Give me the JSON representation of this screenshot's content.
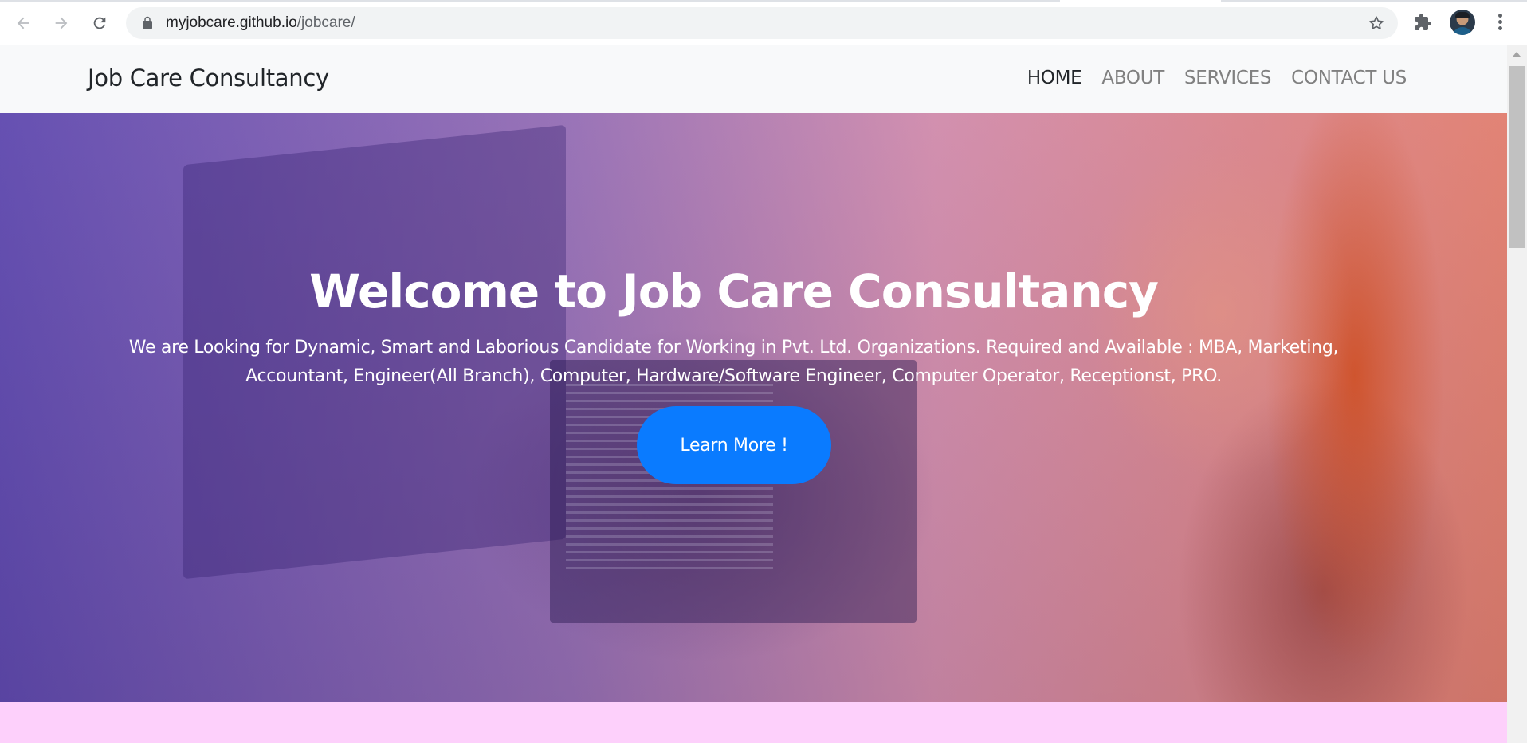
{
  "browser": {
    "url_host": "myjobcare.github.io",
    "url_path": "/jobcare/",
    "back_icon": "arrow-left-icon",
    "forward_icon": "arrow-right-icon",
    "reload_icon": "reload-icon",
    "lock_icon": "lock-icon",
    "bookmark_icon": "star-icon",
    "extensions_icon": "puzzle-icon",
    "menu_icon": "kebab-menu-icon"
  },
  "site": {
    "brand": "Job Care Consultancy",
    "nav": [
      {
        "label": "HOME",
        "active": true
      },
      {
        "label": "ABOUT",
        "active": false
      },
      {
        "label": "SERVICES",
        "active": false
      },
      {
        "label": "CONTACT US",
        "active": false
      }
    ]
  },
  "hero": {
    "title": "Welcome to Job Care Consultancy",
    "description": "We are Looking for Dynamic, Smart and Laborious Candidate for Working in Pvt. Ltd. Organizations. Required and Available : MBA, Marketing, Accountant, Engineer(All Branch), Computer, Hardware/Software Engineer, Computer Operator, Receptionst, PRO.",
    "cta_label": "Learn More !"
  },
  "colors": {
    "cta": "#0a7bff",
    "navbar_bg": "#f8f9fa",
    "next_section_bg": "#fdd0fb"
  }
}
